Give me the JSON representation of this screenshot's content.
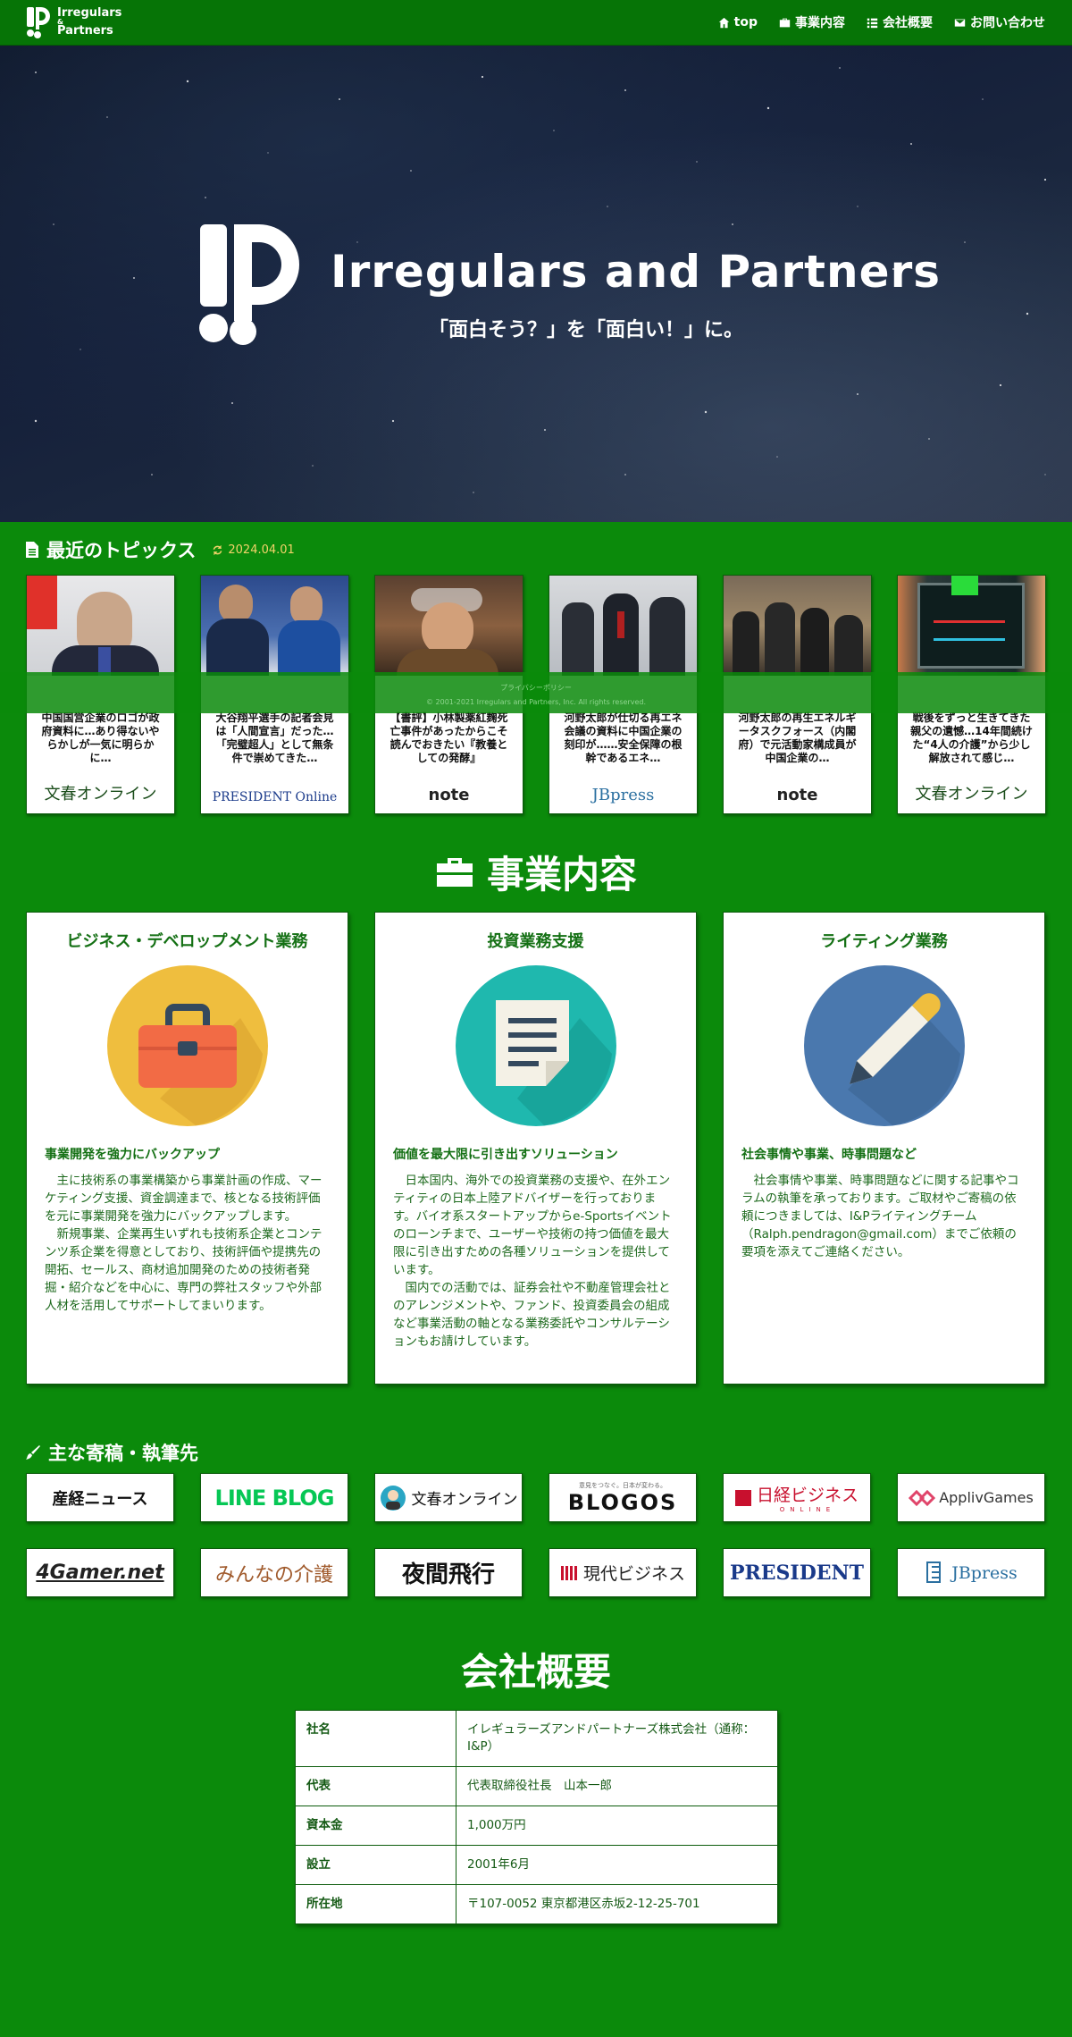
{
  "nav": {
    "brand_line1": "Irregulars",
    "brand_amp": "&",
    "brand_line2": "Partners",
    "links": [
      {
        "label": "top",
        "icon": "home-icon"
      },
      {
        "label": "事業内容",
        "icon": "briefcase-icon"
      },
      {
        "label": "会社概要",
        "icon": "list-icon"
      },
      {
        "label": "お問い合わせ",
        "icon": "envelope-icon"
      }
    ]
  },
  "hero": {
    "title": "Irregulars and Partners",
    "subtitle": "「面白そう？」を「面白い！」に。"
  },
  "topics": {
    "title": "最近のトピックス",
    "date": "2024.04.01",
    "items": [
      {
        "text": "中国国営企業のロゴが政府資料に…あり得ないやらかしが一気に明らかに…",
        "source": "文春オンライン"
      },
      {
        "text": "大谷翔平選手の記者会見は「人間宣言」だった…「完璧超人」として無条件で崇めてきた…",
        "source": "PRESIDENT Online"
      },
      {
        "text": "【書評】小林製薬紅麹死亡事件があったからこそ読んでおきたい『教養としての発酵』",
        "source": "note"
      },
      {
        "text": "河野太郎が仕切る再エネ会議の資料に中国企業の刻印が……安全保障の根幹であるエネ…",
        "source": "JBpress"
      },
      {
        "text": "河野太郎の再生エネルギータスクフォース（内閣府）で元活動家構成員が中国企業の…",
        "source": "note"
      },
      {
        "text": "戦後をずっと生きてきた親父の遺憾…14年間続けた“4人の介護”から少し解放されて感じ…",
        "source": "文春オンライン"
      }
    ]
  },
  "footer": {
    "privacy": "プライバシーポリシー",
    "copyright": "© 2001-2021 Irregulars and Partners, Inc. All rights reserved."
  },
  "business": {
    "title": "事業内容",
    "cards": [
      {
        "title": "ビジネス・デベロップメント業務",
        "subtitle": "事業開発を強力にバックアップ",
        "paragraphs": [
          "主に技術系の事業構築から事業計画の作成、マーケティング支援、資金調達まで、核となる技術評価を元に事業開発を強力にバックアップします。",
          "新規事業、企業再生いずれも技術系企業とコンテンツ系企業を得意としており、技術評価や提携先の開拓、セールス、商材追加開発のための技術者発掘・紹介などを中心に、専門の弊社スタッフや外部人材を活用してサポートしてまいります。"
        ],
        "icon": "briefcase-icon",
        "color": "#f0c040"
      },
      {
        "title": "投資業務支援",
        "subtitle": "価値を最大限に引き出すソリューション",
        "paragraphs": [
          "日本国内、海外での投資業務の支援や、在外エンティティの日本上陸アドバイザーを行っております。バイオ系スタートアップからe-Sportsイベントのローンチまで、ユーザーや技術の持つ価値を最大限に引き出すための各種ソリューションを提供しています。",
          "国内での活動では、証券会社や不動産管理会社とのアレンジメントや、ファンド、投資委員会の組成など事業活動の軸となる業務委託やコンサルテーションもお請けしています。"
        ],
        "icon": "document-icon",
        "color": "#20b8b0"
      },
      {
        "title": "ライティング業務",
        "subtitle": "社会事情や事業、時事問題など",
        "paragraphs": [
          "社会事情や事業、時事問題などに関する記事やコラムの執筆を承っております。ご取材やご寄稿の依頼につきましては、I&Pライティングチーム（Ralph.pendragon@gmail.com）までご依頼の要項を添えてご連絡ください。"
        ],
        "icon": "pencil-icon",
        "color": "#4a7ab0"
      }
    ]
  },
  "contrib": {
    "title": "主な寄稿・執筆先",
    "logos": [
      "産経ニュース",
      "LINE BLOG",
      "文春オンライン",
      "BLOGOS",
      "日経ビジネス",
      "ApplivGames",
      "4Gamer.net",
      "みんなの介護",
      "夜間飛行",
      "現代ビジネス",
      "PRESIDENT",
      "JBpress"
    ],
    "blogos_tagline": "意見をつなぐ。日本が変わる。",
    "nikkei_sub": "ONLINE"
  },
  "company": {
    "title": "会社概要",
    "rows": [
      {
        "k": "社名",
        "v": "イレギュラーズアンドパートナーズ株式会社（通称：I&P）"
      },
      {
        "k": "代表",
        "v": "代表取締役社長　山本一郎"
      },
      {
        "k": "資本金",
        "v": "1,000万円"
      },
      {
        "k": "設立",
        "v": "2001年6月"
      },
      {
        "k": "所在地",
        "v": "〒107-0052 東京都港区赤坂2-12-25-701"
      }
    ]
  }
}
